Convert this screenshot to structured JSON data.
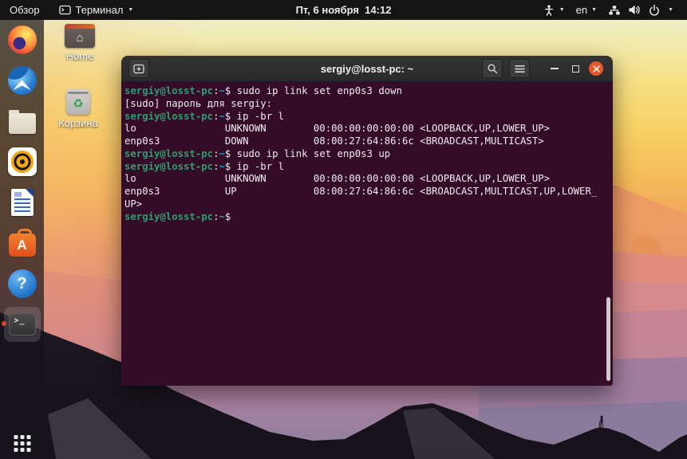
{
  "top_bar": {
    "activities_label": "Обзор",
    "app_menu_label": "Терминал",
    "clock": "Пт, 6 ноября  14:12",
    "keyboard_layout_label": "en"
  },
  "desktop_icons": [
    {
      "label": "Home",
      "icon": "home-folder-icon"
    },
    {
      "label": "Корзина",
      "icon": "trash-icon"
    }
  ],
  "dock": {
    "items": [
      {
        "icon": "firefox-icon"
      },
      {
        "icon": "thunderbird-icon"
      },
      {
        "icon": "files-icon"
      },
      {
        "icon": "rhythmbox-icon"
      },
      {
        "icon": "libreoffice-writer-icon"
      },
      {
        "icon": "ubuntu-software-icon"
      },
      {
        "icon": "help-icon"
      },
      {
        "icon": "terminal-icon",
        "running": true,
        "active": true
      }
    ],
    "software_letter": "A",
    "help_glyph": "?",
    "terminal_glyph": ">_"
  },
  "terminal": {
    "title": "sergiy@losst-pc: ~",
    "lines": [
      [
        {
          "c": "g",
          "t": "sergiy@losst-pc"
        },
        {
          "c": "f",
          "t": ":"
        },
        {
          "c": "b",
          "t": "~"
        },
        {
          "c": "f",
          "t": "$ sudo ip link set enp0s3 down"
        }
      ],
      [
        {
          "c": "f",
          "t": "[sudo] пароль для sergiy: "
        }
      ],
      [
        {
          "c": "g",
          "t": "sergiy@losst-pc"
        },
        {
          "c": "f",
          "t": ":"
        },
        {
          "c": "b",
          "t": "~"
        },
        {
          "c": "f",
          "t": "$ ip -br l"
        }
      ],
      [
        {
          "c": "f",
          "t": "lo               UNKNOWN        00:00:00:00:00:00 <LOOPBACK,UP,LOWER_UP> "
        }
      ],
      [
        {
          "c": "f",
          "t": "enp0s3           DOWN           08:00:27:64:86:6c <BROADCAST,MULTICAST> "
        }
      ],
      [
        {
          "c": "g",
          "t": "sergiy@losst-pc"
        },
        {
          "c": "f",
          "t": ":"
        },
        {
          "c": "b",
          "t": "~"
        },
        {
          "c": "f",
          "t": "$ sudo ip link set enp0s3 up"
        }
      ],
      [
        {
          "c": "g",
          "t": "sergiy@losst-pc"
        },
        {
          "c": "f",
          "t": ":"
        },
        {
          "c": "b",
          "t": "~"
        },
        {
          "c": "f",
          "t": "$ ip -br l"
        }
      ],
      [
        {
          "c": "f",
          "t": "lo               UNKNOWN        00:00:00:00:00:00 <LOOPBACK,UP,LOWER_UP> "
        }
      ],
      [
        {
          "c": "f",
          "t": "enp0s3           UP             08:00:27:64:86:6c <BROADCAST,MULTICAST,UP,LOWER_"
        }
      ],
      [
        {
          "c": "f",
          "t": "UP> "
        }
      ],
      [
        {
          "c": "g",
          "t": "sergiy@losst-pc"
        },
        {
          "c": "f",
          "t": ":"
        },
        {
          "c": "b",
          "t": "~"
        },
        {
          "c": "f",
          "t": "$ "
        }
      ]
    ]
  },
  "colors": {
    "close_button": "#e9572e",
    "terminal_background": "#340c28",
    "prompt_green": "#2f9e6e",
    "path_blue": "#2a9fb0",
    "terminal_foreground": "#f1ebf1",
    "running_dot": "#e0442a"
  }
}
